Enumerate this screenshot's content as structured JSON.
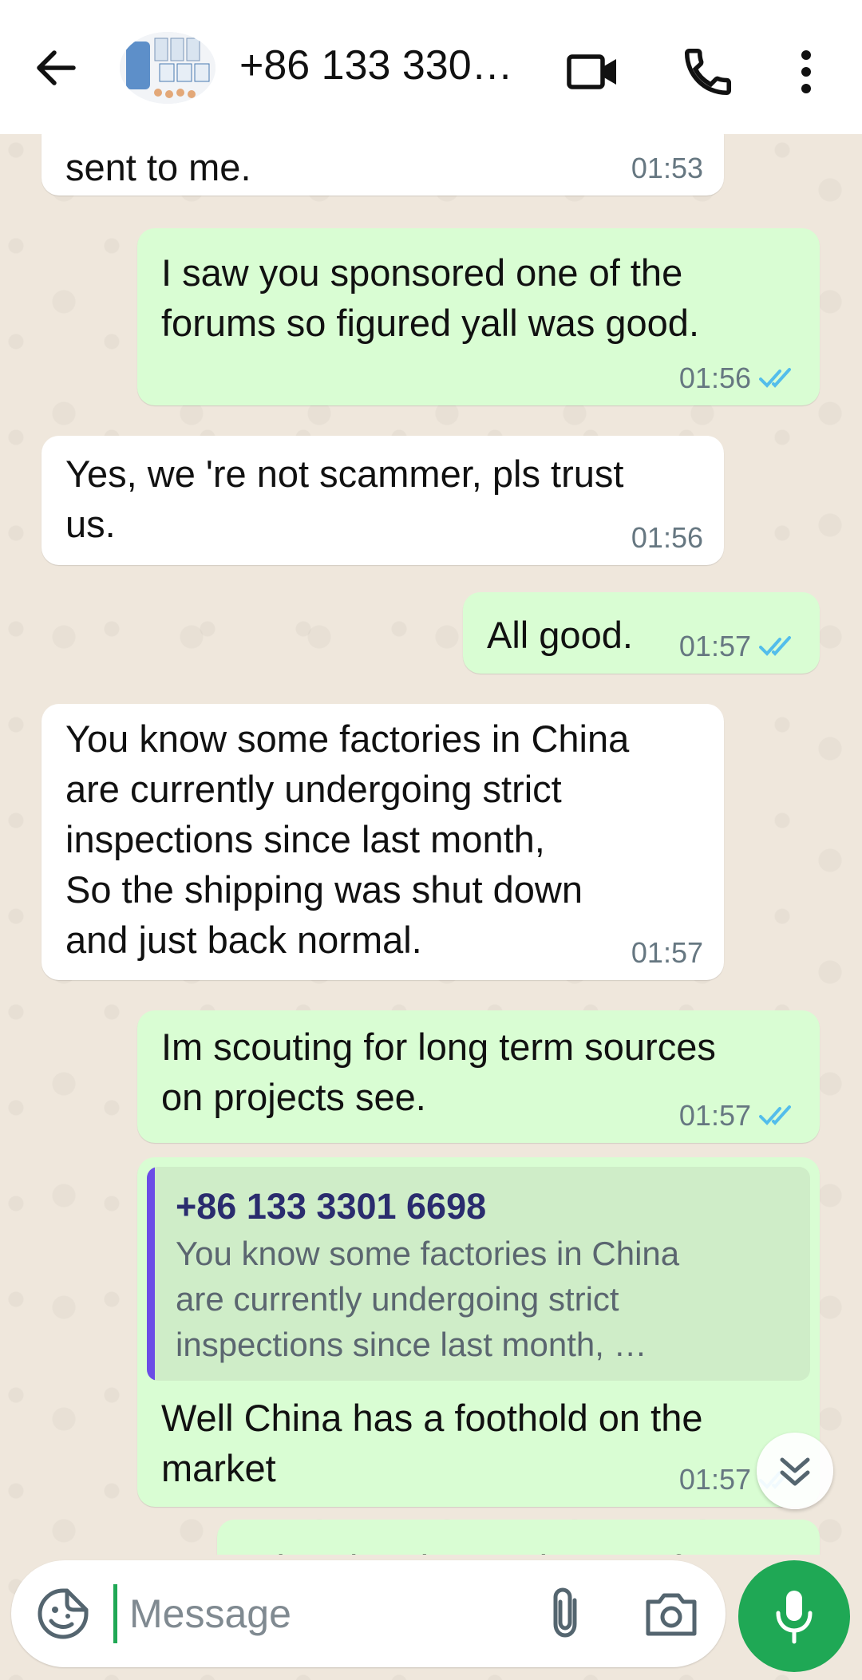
{
  "header": {
    "contact_name": "+86 133 330…",
    "icons": [
      "back-arrow-icon",
      "video-call-icon",
      "phone-icon",
      "more-vertical-icon"
    ]
  },
  "messages": [
    {
      "dir": "in",
      "text": "sent to me.",
      "time": "01:53"
    },
    {
      "dir": "out",
      "text": "I saw you sponsored one of the\nforums so figured yall was good.",
      "time": "01:56",
      "status": "read"
    },
    {
      "dir": "in",
      "text": "Yes, we 're not scammer, pls trust\nus.",
      "time": "01:56"
    },
    {
      "dir": "out",
      "text": "All good.",
      "time": "01:57",
      "status": "read"
    },
    {
      "dir": "in",
      "text": "You know some factories in China\nare currently undergoing strict\ninspections since last month,\nSo the shipping was shut down\nand just back normal.",
      "time": "01:57"
    },
    {
      "dir": "out",
      "text": "Im scouting for long term sources\non projects see.",
      "time": "01:57",
      "status": "read"
    },
    {
      "dir": "out",
      "quote_author": "+86 133 3301 6698",
      "quote_text": "You know some factories in China\nare currently undergoing strict\ninspections since last month, …",
      "text": "Well China has a foothold on the\nmarket",
      "time": "01:57",
      "status": "read"
    },
    {
      "dir": "out",
      "text": "What they inspecting you for?",
      "partial": true
    }
  ],
  "composer": {
    "placeholder": "Message",
    "icons": [
      "emoji-sticker-icon",
      "attach-paperclip-icon",
      "camera-icon",
      "microphone-icon"
    ]
  },
  "colors": {
    "outgoing_bubble": "#d9fdd3",
    "incoming_bubble": "#ffffff",
    "wallpaper": "#efe7dc",
    "accent_green": "#1fa855",
    "read_ticks": "#53bdeb",
    "quote_bar": "#6b4de6"
  }
}
